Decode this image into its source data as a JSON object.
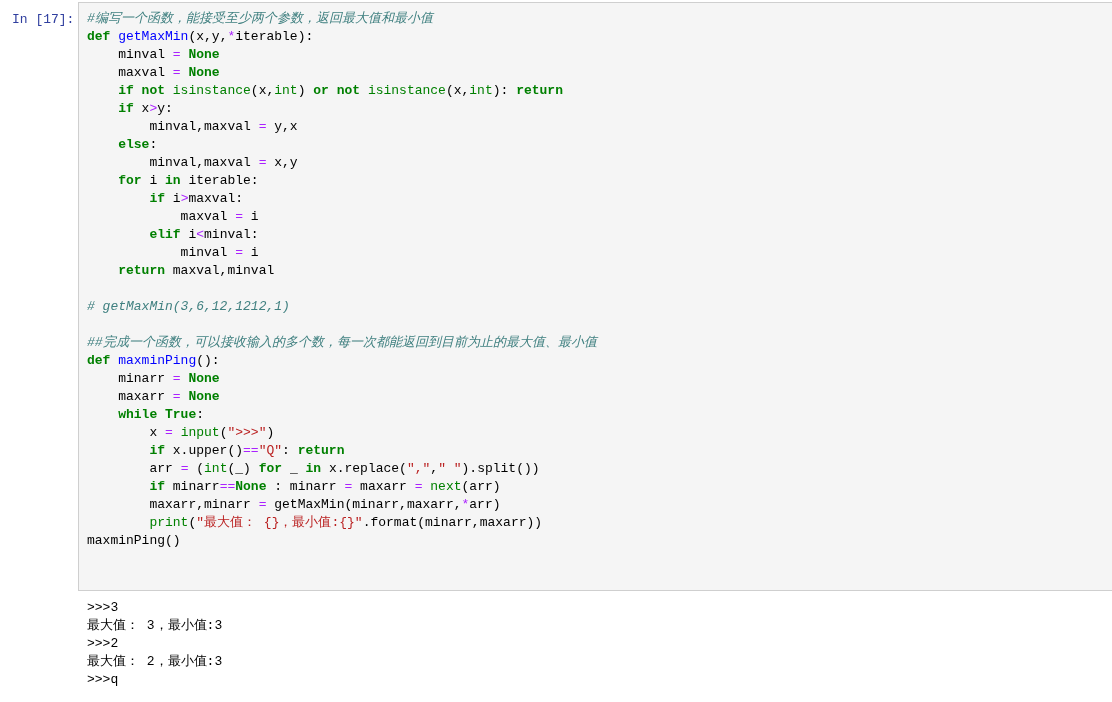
{
  "cell": {
    "prompt": "In [17]:",
    "lines": [
      {
        "kind": "code",
        "tokens": [
          {
            "kind": "comment",
            "text": "#编写一个函数，能接受至少两个参数，返回最大值和最小值"
          }
        ]
      },
      {
        "kind": "code",
        "tokens": [
          {
            "kind": "keyword",
            "text": "def"
          },
          {
            "kind": "defname",
            "text": " getMaxMin"
          },
          {
            "kind": "plain",
            "text": "(x,y,"
          },
          {
            "kind": "operator",
            "text": "*"
          },
          {
            "kind": "plain",
            "text": "iterable):"
          }
        ]
      },
      {
        "kind": "code",
        "tokens": [
          {
            "kind": "plain",
            "text": "    minval "
          },
          {
            "kind": "operator",
            "text": "="
          },
          {
            "kind": "keyword",
            "text": " None"
          }
        ]
      },
      {
        "kind": "code",
        "tokens": [
          {
            "kind": "plain",
            "text": "    maxval "
          },
          {
            "kind": "operator",
            "text": "="
          },
          {
            "kind": "keyword",
            "text": " None"
          }
        ]
      },
      {
        "kind": "code",
        "tokens": [
          {
            "kind": "keyword",
            "text": "    if not"
          },
          {
            "kind": "builtin",
            "text": " isinstance"
          },
          {
            "kind": "plain",
            "text": "(x,"
          },
          {
            "kind": "builtin",
            "text": "int"
          },
          {
            "kind": "plain",
            "text": ")"
          },
          {
            "kind": "keyword",
            "text": " or not"
          },
          {
            "kind": "builtin",
            "text": " isinstance"
          },
          {
            "kind": "plain",
            "text": "(x,"
          },
          {
            "kind": "builtin",
            "text": "int"
          },
          {
            "kind": "plain",
            "text": "):"
          },
          {
            "kind": "keyword",
            "text": " return"
          }
        ]
      },
      {
        "kind": "code",
        "tokens": [
          {
            "kind": "keyword",
            "text": "    if"
          },
          {
            "kind": "plain",
            "text": " x"
          },
          {
            "kind": "operator",
            "text": ">"
          },
          {
            "kind": "plain",
            "text": "y:"
          }
        ]
      },
      {
        "kind": "code",
        "tokens": [
          {
            "kind": "plain",
            "text": "        minval,maxval "
          },
          {
            "kind": "operator",
            "text": "="
          },
          {
            "kind": "plain",
            "text": " y,x"
          }
        ]
      },
      {
        "kind": "code",
        "tokens": [
          {
            "kind": "keyword",
            "text": "    else"
          },
          {
            "kind": "plain",
            "text": ":"
          }
        ]
      },
      {
        "kind": "code",
        "tokens": [
          {
            "kind": "plain",
            "text": "        minval,maxval "
          },
          {
            "kind": "operator",
            "text": "="
          },
          {
            "kind": "plain",
            "text": " x,y"
          }
        ]
      },
      {
        "kind": "code",
        "tokens": [
          {
            "kind": "keyword",
            "text": "    for"
          },
          {
            "kind": "plain",
            "text": " i "
          },
          {
            "kind": "keyword",
            "text": "in"
          },
          {
            "kind": "plain",
            "text": " iterable:"
          }
        ]
      },
      {
        "kind": "code",
        "tokens": [
          {
            "kind": "keyword",
            "text": "        if"
          },
          {
            "kind": "plain",
            "text": " i"
          },
          {
            "kind": "operator",
            "text": ">"
          },
          {
            "kind": "plain",
            "text": "maxval:"
          }
        ]
      },
      {
        "kind": "code",
        "tokens": [
          {
            "kind": "plain",
            "text": "            maxval "
          },
          {
            "kind": "operator",
            "text": "="
          },
          {
            "kind": "plain",
            "text": " i"
          }
        ]
      },
      {
        "kind": "code",
        "tokens": [
          {
            "kind": "keyword",
            "text": "        elif"
          },
          {
            "kind": "plain",
            "text": " i"
          },
          {
            "kind": "operator",
            "text": "<"
          },
          {
            "kind": "plain",
            "text": "minval:"
          }
        ]
      },
      {
        "kind": "code",
        "tokens": [
          {
            "kind": "plain",
            "text": "            minval "
          },
          {
            "kind": "operator",
            "text": "="
          },
          {
            "kind": "plain",
            "text": " i"
          }
        ]
      },
      {
        "kind": "code",
        "tokens": [
          {
            "kind": "keyword",
            "text": "    return"
          },
          {
            "kind": "plain",
            "text": " maxval,minval"
          }
        ]
      },
      {
        "kind": "blank"
      },
      {
        "kind": "code",
        "tokens": [
          {
            "kind": "comment",
            "text": "# getMaxMin(3,6,12,1212,1)"
          }
        ]
      },
      {
        "kind": "blank"
      },
      {
        "kind": "code",
        "tokens": [
          {
            "kind": "comment",
            "text": "##完成一个函数，可以接收输入的多个数，每一次都能返回到目前为止的最大值、最小值"
          }
        ]
      },
      {
        "kind": "code",
        "tokens": [
          {
            "kind": "keyword",
            "text": "def"
          },
          {
            "kind": "defname",
            "text": " maxminPing"
          },
          {
            "kind": "plain",
            "text": "():"
          }
        ]
      },
      {
        "kind": "code",
        "tokens": [
          {
            "kind": "plain",
            "text": "    minarr "
          },
          {
            "kind": "operator",
            "text": "="
          },
          {
            "kind": "keyword",
            "text": " None"
          }
        ]
      },
      {
        "kind": "code",
        "tokens": [
          {
            "kind": "plain",
            "text": "    maxarr "
          },
          {
            "kind": "operator",
            "text": "="
          },
          {
            "kind": "keyword",
            "text": " None"
          }
        ]
      },
      {
        "kind": "code",
        "tokens": [
          {
            "kind": "keyword",
            "text": "    while True"
          },
          {
            "kind": "plain",
            "text": ":"
          }
        ]
      },
      {
        "kind": "code",
        "tokens": [
          {
            "kind": "plain",
            "text": "        x "
          },
          {
            "kind": "operator",
            "text": "="
          },
          {
            "kind": "builtin",
            "text": " input"
          },
          {
            "kind": "plain",
            "text": "("
          },
          {
            "kind": "string",
            "text": "\">>>\""
          },
          {
            "kind": "plain",
            "text": ")"
          }
        ]
      },
      {
        "kind": "code",
        "tokens": [
          {
            "kind": "keyword",
            "text": "        if"
          },
          {
            "kind": "plain",
            "text": " x.upper()"
          },
          {
            "kind": "operator",
            "text": "=="
          },
          {
            "kind": "string",
            "text": "\"Q\""
          },
          {
            "kind": "plain",
            "text": ":"
          },
          {
            "kind": "keyword",
            "text": " return"
          }
        ]
      },
      {
        "kind": "code",
        "tokens": [
          {
            "kind": "plain",
            "text": "        arr "
          },
          {
            "kind": "operator",
            "text": "="
          },
          {
            "kind": "plain",
            "text": " ("
          },
          {
            "kind": "builtin",
            "text": "int"
          },
          {
            "kind": "plain",
            "text": "(_) "
          },
          {
            "kind": "keyword",
            "text": "for"
          },
          {
            "kind": "plain",
            "text": " _ "
          },
          {
            "kind": "keyword",
            "text": "in"
          },
          {
            "kind": "plain",
            "text": " x.replace("
          },
          {
            "kind": "string",
            "text": "\",\""
          },
          {
            "kind": "plain",
            "text": ","
          },
          {
            "kind": "string",
            "text": "\" \""
          },
          {
            "kind": "plain",
            "text": ").split())"
          }
        ]
      },
      {
        "kind": "code",
        "tokens": [
          {
            "kind": "keyword",
            "text": "        if"
          },
          {
            "kind": "plain",
            "text": " minarr"
          },
          {
            "kind": "operator",
            "text": "=="
          },
          {
            "kind": "keyword",
            "text": "None"
          },
          {
            "kind": "plain",
            "text": " : minarr "
          },
          {
            "kind": "operator",
            "text": "="
          },
          {
            "kind": "plain",
            "text": " maxarr "
          },
          {
            "kind": "operator",
            "text": "="
          },
          {
            "kind": "builtin",
            "text": " next"
          },
          {
            "kind": "plain",
            "text": "(arr)"
          }
        ]
      },
      {
        "kind": "code",
        "tokens": [
          {
            "kind": "plain",
            "text": "        maxarr,minarr "
          },
          {
            "kind": "operator",
            "text": "="
          },
          {
            "kind": "plain",
            "text": " getMaxMin(minarr,maxarr,"
          },
          {
            "kind": "operator",
            "text": "*"
          },
          {
            "kind": "plain",
            "text": "arr)"
          }
        ]
      },
      {
        "kind": "code",
        "tokens": [
          {
            "kind": "builtin",
            "text": "        print"
          },
          {
            "kind": "plain",
            "text": "("
          },
          {
            "kind": "string",
            "text": "\"最大值： {}，最小值:{}\""
          },
          {
            "kind": "plain",
            "text": ".format(minarr,maxarr))"
          }
        ]
      },
      {
        "kind": "code",
        "tokens": [
          {
            "kind": "plain",
            "text": "maxminPing()"
          }
        ]
      }
    ],
    "output": [
      ">>>3",
      "最大值： 3，最小值:3",
      ">>>2",
      "最大值： 2，最小值:3",
      ">>>q"
    ]
  }
}
